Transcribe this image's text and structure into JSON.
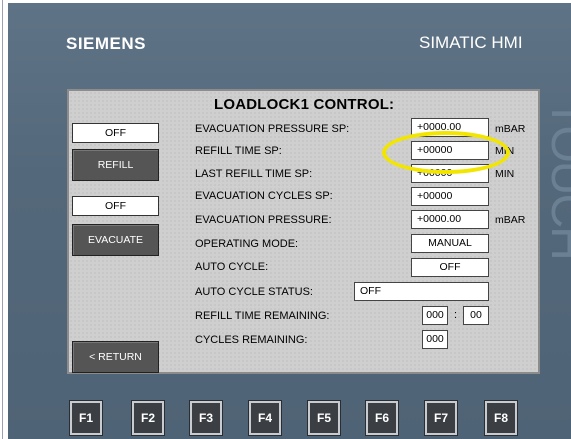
{
  "panel": {
    "brand": "SIEMENS",
    "model": "SIMATIC HMI",
    "touch_label": "TOUCH"
  },
  "screen": {
    "title": "LOADLOCK1 CONTROL:",
    "left_panel": {
      "refill_status": "OFF",
      "refill_button": "REFILL",
      "evacuate_status": "OFF",
      "evacuate_button": "EVACUATE",
      "return_button": "< RETURN"
    },
    "rows": [
      {
        "label": "EVACUATION PRESSURE SP:",
        "value": "+0000.00",
        "unit": "mBAR"
      },
      {
        "label": "REFILL TIME SP:",
        "value": "+00000",
        "unit": "MIN"
      },
      {
        "label": "LAST REFILL TIME SP:",
        "value": "+00000",
        "unit": "MIN"
      },
      {
        "label": "EVACUATION CYCLES SP:",
        "value": "+00000",
        "unit": ""
      },
      {
        "label": "EVACUATION PRESSURE:",
        "value": "+0000.00",
        "unit": "mBAR"
      },
      {
        "label": "OPERATING MODE:",
        "value": "MANUAL",
        "unit": ""
      },
      {
        "label": "AUTO CYCLE:",
        "value": "OFF",
        "unit": ""
      },
      {
        "label": "AUTO CYCLE STATUS:",
        "value": "OFF",
        "unit": ""
      },
      {
        "label": "REFILL TIME REMAINING:",
        "value_min": "000",
        "separator": ":",
        "value_sec": "00"
      },
      {
        "label": "CYCLES REMAINING:",
        "value": "000",
        "unit": ""
      }
    ]
  },
  "function_keys": [
    "F1",
    "F2",
    "F3",
    "F4",
    "F5",
    "F6",
    "F7",
    "F8"
  ],
  "colors": {
    "bezel": "#56697c",
    "screen_bg": "#cfcfcf",
    "button_bg": "#555555",
    "highlight": "#f2e600",
    "fkey_bg": "#3b3f44"
  }
}
